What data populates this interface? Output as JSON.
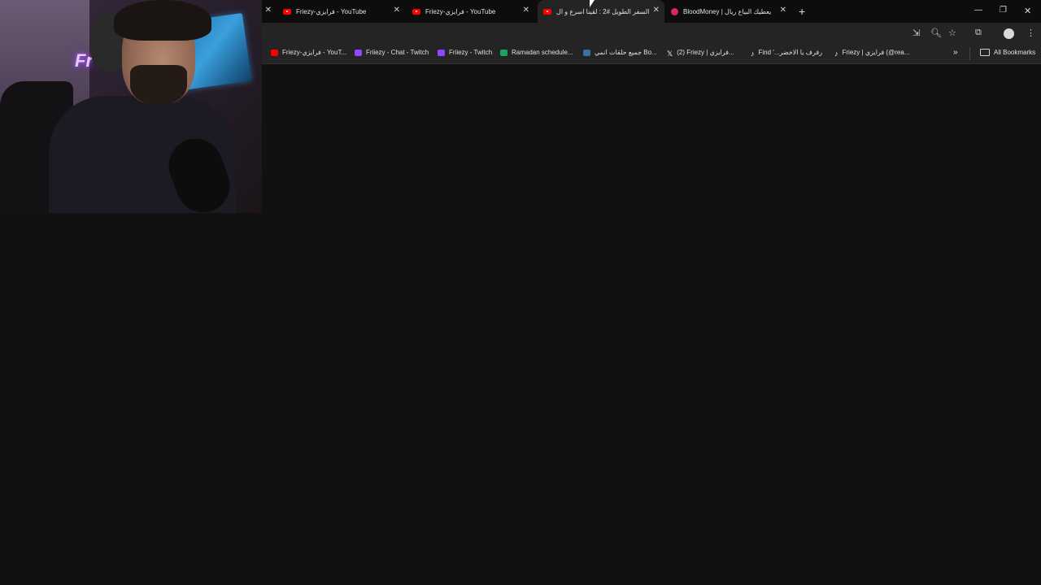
{
  "tabs": [
    {
      "title": "Friezy-فرايزي - YouTube",
      "icon": "youtube-icon"
    },
    {
      "title": "Friezy-فرايزي - YouTube",
      "icon": "youtube-icon"
    },
    {
      "title": "السفر الطويل #2 : لقينا اسرع و ال",
      "icon": "youtube-icon",
      "active": true
    },
    {
      "title": "BloodMoney | يعطيك البياع ريال",
      "icon": "bloodmoney-icon"
    }
  ],
  "bookmarks": [
    {
      "label": "Friezy-فرايزي - YouT...",
      "icon": "youtube-icon"
    },
    {
      "label": "Friiezy - Chat - Twitch",
      "icon": "twitch-icon"
    },
    {
      "label": "Friiezy - Twitch",
      "icon": "twitch-icon"
    },
    {
      "label": "Ramadan schedule...",
      "icon": "sheets-icon"
    },
    {
      "label": "جميع حلقات انمي Bo...",
      "icon": "anime-site-icon"
    },
    {
      "label": "(2) Friezy | فرايزي...",
      "icon": "x-icon"
    },
    {
      "label": "Find '...رفرف يا الاخضر",
      "icon": "tiktok-icon"
    },
    {
      "label": "Friezy | فرايزي (@rea...",
      "icon": "tiktok-icon"
    }
  ],
  "all_bookmarks_label": "All Bookmarks",
  "webcam_sign_text": "Fr"
}
